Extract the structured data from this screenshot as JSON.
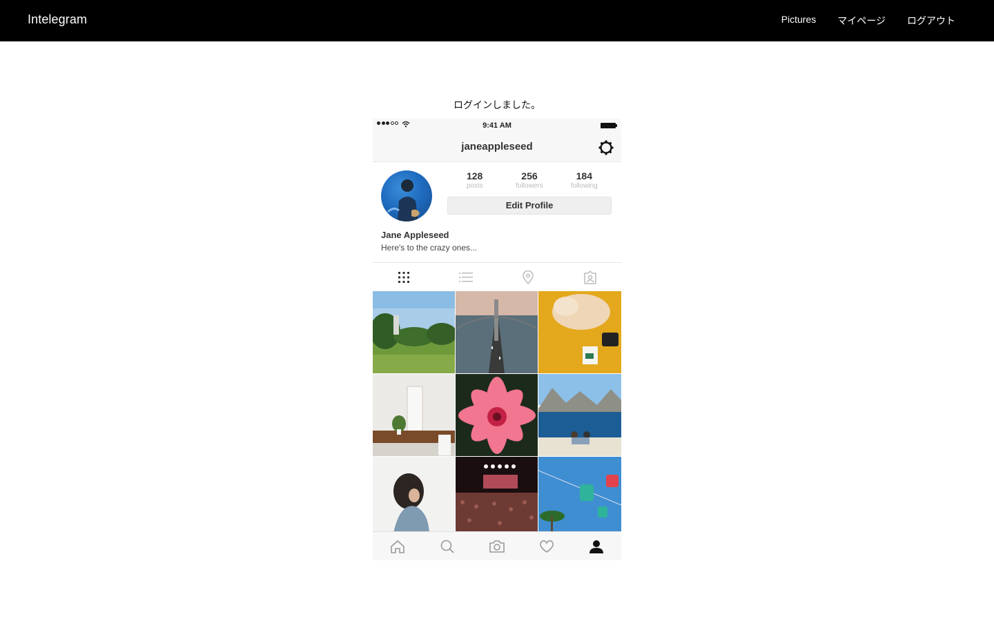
{
  "navbar": {
    "brand": "Intelegram",
    "links": [
      "Pictures",
      "マイページ",
      "ログアウト"
    ]
  },
  "flash_message": "ログインしました。",
  "phone": {
    "status_bar": {
      "time": "9:41 AM"
    },
    "header": {
      "username": "janeappleseed",
      "icon": "gear-icon"
    },
    "profile": {
      "stats": [
        {
          "value": "128",
          "label": "posts"
        },
        {
          "value": "256",
          "label": "followers"
        },
        {
          "value": "184",
          "label": "following"
        }
      ],
      "edit_button": "Edit Profile",
      "full_name": "Jane Appleseed",
      "bio": "Here's to the crazy ones..."
    },
    "tabs": [
      "grid-icon",
      "list-icon",
      "location-pin-icon",
      "tagged-photos-icon"
    ],
    "tab_bar": [
      "home-icon",
      "search-icon",
      "camera-icon",
      "heart-icon",
      "profile-icon"
    ]
  }
}
